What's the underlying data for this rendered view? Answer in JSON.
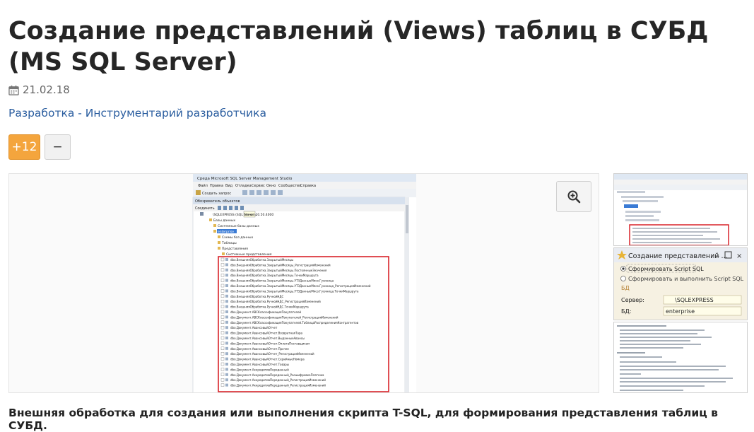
{
  "article": {
    "title": "Создание представлений (Views) таблиц в СУБД (MS SQL Server)",
    "date": "21.02.18",
    "category": "Разработка - Инструментарий разработчика",
    "vote_plus": "+12",
    "vote_minus": "−",
    "caption": "Внешняя обработка для создания или выполнения скрипта T-SQL, для формирования представления таблиц в СУБД."
  },
  "screenshot_main": {
    "window_title": "Среда Microsoft SQL Server Management Studio",
    "menu": [
      "Файл",
      "Правка",
      "Вид",
      "Отладка",
      "Сервис",
      "Окно",
      "Сообщество",
      "Справка"
    ],
    "toolbar_label": "Создать запрос",
    "explorer_title": "Обозреватель объектов",
    "connect_label": "Соединить",
    "tooltip": "Начать",
    "server": "\\SQLEXPRESS (SQL Server 10.50.4000",
    "tree": [
      "Базы данных",
      "Системные базы данных",
      "enterprise",
      "Схемы баз данных",
      "Таблицы",
      "Представления",
      "Системные представления"
    ],
    "views": [
      "dbo.ВнешняяОбработка.ЗакрытыйМесяцы",
      "dbo.ВнешняяОбработка.ЗакрытыйМесяцы_РегистрацияИзменений",
      "dbo.ВнешняяОбработка.ЗакрытыйМесяцы.ПостоянныеЗначения",
      "dbo.ВнешняяОбработка.ЗакрытыйМесяцы.ТочкиМаршрута",
      "dbo.ВнешняяОбработка.ЗакрытыйМесяцы.УТЗДанныеМясо.Гусиница",
      "dbo.ВнешняяОбработка.ЗакрытыйМесяцы.УТЗДанныеМясо.Гусиница_РегистрацияИзменений",
      "dbo.ВнешняяОбработка.ЗакрытыйМесяцы.УТЗДанныеМясо.Гусиница.ТочкиМаршрута",
      "dbo.ВнешняяОбработка.РучнойНДС",
      "dbo.ВнешняяОбработка.РучнойНДС_РегистрацияИзменений",
      "dbo.ВнешняяОбработка.РучнойНДС.ТочкиМаршрута",
      "dbo.Документ.ABCКлассификацияПокупателей",
      "dbo.Документ.ABCКлассификацияПокупателей_РегистрацияИзменений",
      "dbo.Документ.ABCКлассификацияПокупателей.ТаблицаРаспределенияКонтрагентов",
      "dbo.Документ.АвансовыйОтчет",
      "dbo.Документ.АвансовыйОтчет.ВозвратнаяТара",
      "dbo.Документ.АвансовыйОтчет.ВыданныеАвансы",
      "dbo.Документ.АвансовыйОтчет.ОплатаПоставщикам",
      "dbo.Документ.АвансовыйОтчет.Прочее",
      "dbo.Документ.АвансовыйОтчет_РегистрацияИзменений",
      "dbo.Документ.АвансовыйОтчет.СерийныеНомера",
      "dbo.Документ.АвансовыйОтчет.Товары",
      "dbo.Документ.АккредитивПереданный",
      "dbo.Документ.АккредитивПереданный_РасшифровкаПлатежа",
      "dbo.Документ.АккредитивПереданный_РегистрацияИзменений",
      "dbo.Документ.АккредитивПереданный_РегистрацияИзменений"
    ]
  },
  "screenshot_thumb": {
    "dialog_title": "Создание представлений ...",
    "dialog_icon": "star-icon",
    "option_generate": "Сформировать Script SQL",
    "option_generate_exec": "Сформировать и выполнить Script SQL",
    "section_label": "БД",
    "server_label": "Сервер:",
    "server_value": "\\SQLEXPRESS",
    "db_label": "БД:",
    "db_value": "enterprise"
  },
  "colors": {
    "accent_orange": "#f4a53d",
    "link_blue": "#2a5d9f",
    "highlight_red": "#d9232a"
  },
  "icons": [
    "calendar-icon",
    "zoom-in-icon"
  ]
}
